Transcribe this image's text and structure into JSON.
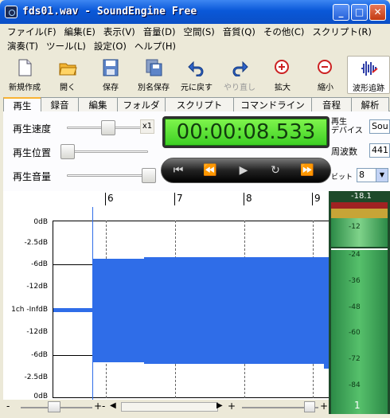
{
  "window": {
    "title": "fds01.wav - SoundEngine Free",
    "min": "_",
    "max": "□",
    "close": "✕"
  },
  "menu": {
    "row1": [
      "ファイル(F)",
      "編集(E)",
      "表示(V)",
      "音量(D)",
      "空間(S)",
      "音質(Q)",
      "その他(C)",
      "スクリプト(R)"
    ],
    "row2": [
      "演奏(T)",
      "ツール(L)",
      "設定(O)",
      "ヘルプ(H)"
    ]
  },
  "toolbar": [
    {
      "label": "新規作成",
      "icon": "new-file-icon"
    },
    {
      "label": "開く",
      "icon": "open-folder-icon"
    },
    {
      "label": "保存",
      "icon": "save-icon"
    },
    {
      "label": "別名保存",
      "icon": "save-as-icon"
    },
    {
      "label": "元に戻す",
      "icon": "undo-icon"
    },
    {
      "label": "やり直し",
      "icon": "redo-icon"
    },
    {
      "label": "拡大",
      "icon": "zoom-in-icon"
    },
    {
      "label": "縮小",
      "icon": "zoom-out-icon"
    },
    {
      "label": "波形追跡",
      "icon": "waveform-follow-icon"
    }
  ],
  "tabs": [
    "再生",
    "録音",
    "編集",
    "フォルダ",
    "スクリプト",
    "コマンドライン",
    "音程",
    "解析"
  ],
  "playback": {
    "speed_label": "再生速度",
    "position_label": "再生位置",
    "volume_label": "再生音量",
    "speed_mult": "x1",
    "time": "00:00:08.533",
    "speed_level": 0.5,
    "position_level": 0.0,
    "volume_level": 1.0
  },
  "device": {
    "label": "再生\nデバイス",
    "value": "Sou",
    "freq_label": "周波数",
    "freq_value": "441",
    "bit_label": "ビット",
    "bit_value": "8"
  },
  "ruler": [
    "6",
    "7",
    "8",
    "9"
  ],
  "db_labels": [
    "0dB",
    "-2.5dB",
    "-6dB",
    "-12dB",
    "1ch -InfdB",
    "-12dB",
    "-6dB",
    "-2.5dB",
    "0dB"
  ],
  "meter": {
    "peak": "-18.1",
    "ticks": [
      "-12",
      "-24",
      "-36",
      "-48",
      "-60",
      "-72",
      "-84"
    ],
    "channel": "1"
  },
  "colors": {
    "title": "#0a58d8",
    "wave": "#2f6de8",
    "lcd": "#5ee03a",
    "meter": "#56c06b"
  }
}
